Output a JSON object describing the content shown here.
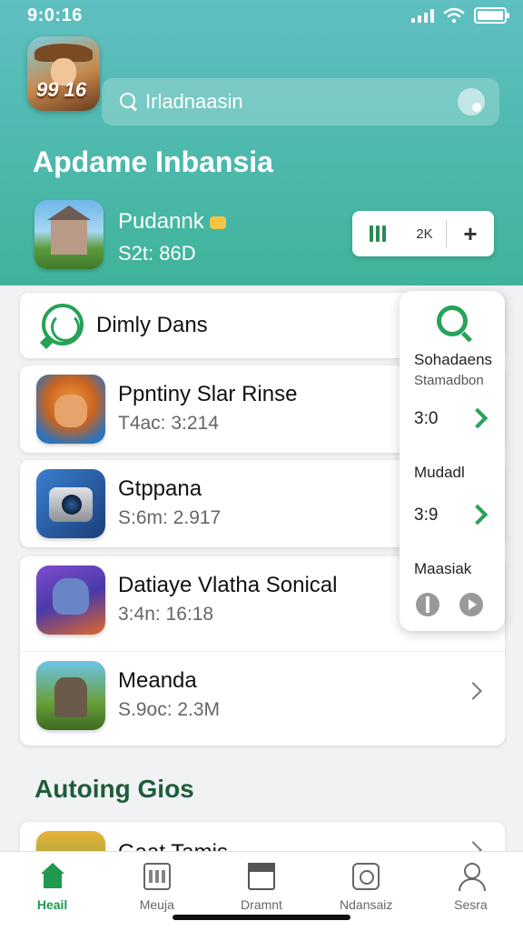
{
  "status_bar": {
    "time": "9:0:16"
  },
  "header": {
    "logo_text": "99 16",
    "search": {
      "placeholder": "Irladnaasin"
    },
    "title": "Apdame Inbansia",
    "featured": {
      "name": "Pudannk",
      "meta": "S2t: 86D"
    },
    "segmented": {
      "middle_label": "2K"
    }
  },
  "section": {
    "label": "Dimly Dans"
  },
  "list": [
    {
      "title": "Ppntiny Slar Rinse",
      "meta": "T4ac: 3:214",
      "thumb_icon": "lion-character-icon"
    },
    {
      "title": "Gtppana",
      "meta": "S:6m: 2.917",
      "thumb_icon": "camera-icon"
    },
    {
      "title": "Datiaye Vlatha Sonical",
      "meta": "3:4n: 16:18",
      "thumb_icon": "wolf-character-icon"
    },
    {
      "title": "Meanda",
      "meta": "S.9oc: 2.3M",
      "thumb_icon": "warrior-character-icon"
    }
  ],
  "side_panel": {
    "title": "Sohadaens",
    "subtitle": "Stamadbon",
    "value1": "3:0",
    "label2": "Mudadl",
    "value2": "3:9",
    "label3": "Maasiak"
  },
  "section2": {
    "heading": "Autoing Gios",
    "peek_item": {
      "title": "Gaat Tamis"
    }
  },
  "bottom_nav": [
    {
      "label": "Heail",
      "icon": "home-icon",
      "active": true
    },
    {
      "label": "Meuja",
      "icon": "calendar-icon"
    },
    {
      "label": "Dramnt",
      "icon": "box-icon"
    },
    {
      "label": "Ndansaiz",
      "icon": "chat-icon"
    },
    {
      "label": "Sesra",
      "icon": "person-icon"
    }
  ],
  "colors": {
    "header_top": "#5fbfc2",
    "header_bottom": "#3fb39a",
    "accent_green": "#1f9a4e",
    "heading_green": "#1f5c3a"
  }
}
